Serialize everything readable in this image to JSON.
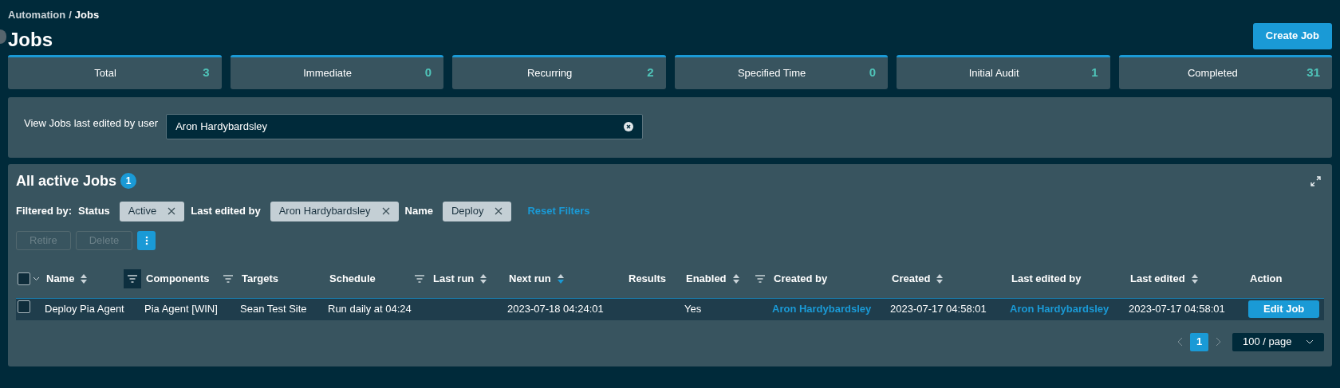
{
  "breadcrumb": {
    "parent": "Automation",
    "separator": "/",
    "current": "Jobs"
  },
  "title": "Jobs",
  "create_button": "Create Job",
  "stats": [
    {
      "label": "Total",
      "value": "3"
    },
    {
      "label": "Immediate",
      "value": "0"
    },
    {
      "label": "Recurring",
      "value": "2"
    },
    {
      "label": "Specified Time",
      "value": "0"
    },
    {
      "label": "Initial Audit",
      "value": "1"
    },
    {
      "label": "Completed",
      "value": "31"
    }
  ],
  "user_filter": {
    "label": "View Jobs last edited by user",
    "value": "Aron Hardybardsley"
  },
  "table_panel": {
    "title": "All active Jobs",
    "count": "1",
    "filters_label": "Filtered by:",
    "filters": [
      {
        "field": "Status",
        "value": "Active"
      },
      {
        "field": "Last edited by",
        "value": "Aron Hardybardsley"
      },
      {
        "field": "Name",
        "value": "Deploy"
      }
    ],
    "reset": "Reset Filters",
    "bulk_actions": [
      {
        "label": "Retire",
        "disabled": true
      },
      {
        "label": "Delete",
        "disabled": true
      }
    ],
    "columns": [
      {
        "label": "Name",
        "sorted": false,
        "filter_active": true
      },
      {
        "label": "Components",
        "filter_active": false
      },
      {
        "label": "Targets"
      },
      {
        "label": "Schedule",
        "filter_active": false
      },
      {
        "label": "Last run",
        "sorted": false
      },
      {
        "label": "Next run",
        "sorted": true
      },
      {
        "label": "Results"
      },
      {
        "label": "Enabled",
        "sorted": false,
        "filter_active": false
      },
      {
        "label": "Created by"
      },
      {
        "label": "Created",
        "sorted": false
      },
      {
        "label": "Last edited by"
      },
      {
        "label": "Last edited",
        "sorted": false
      },
      {
        "label": "Action"
      }
    ],
    "all_checked": false,
    "rows": [
      {
        "checked": false,
        "cells": [
          {
            "kind": "text",
            "text": "Deploy Pia Agent"
          },
          {
            "kind": "text",
            "text": "Pia Agent [WIN]"
          },
          {
            "kind": "text",
            "text": "Sean Test Site"
          },
          {
            "kind": "text",
            "text": "Run daily at 04:24"
          },
          {
            "kind": "empty"
          },
          {
            "kind": "text",
            "text": "2023-07-18 04:24:01"
          },
          {
            "kind": "empty"
          },
          {
            "kind": "text",
            "text": "Yes"
          },
          {
            "kind": "link",
            "text": "Aron Hardybardsley"
          },
          {
            "kind": "text",
            "text": "2023-07-17 04:58:01"
          },
          {
            "kind": "link",
            "text": "Aron Hardybardsley"
          },
          {
            "kind": "text",
            "text": "2023-07-17 04:58:01"
          },
          {
            "kind": "button",
            "text": "Edit Job"
          }
        ]
      }
    ],
    "pagination": {
      "pages": [
        {
          "label": "1",
          "selected": true
        }
      ],
      "page_size": "100 / page"
    }
  }
}
